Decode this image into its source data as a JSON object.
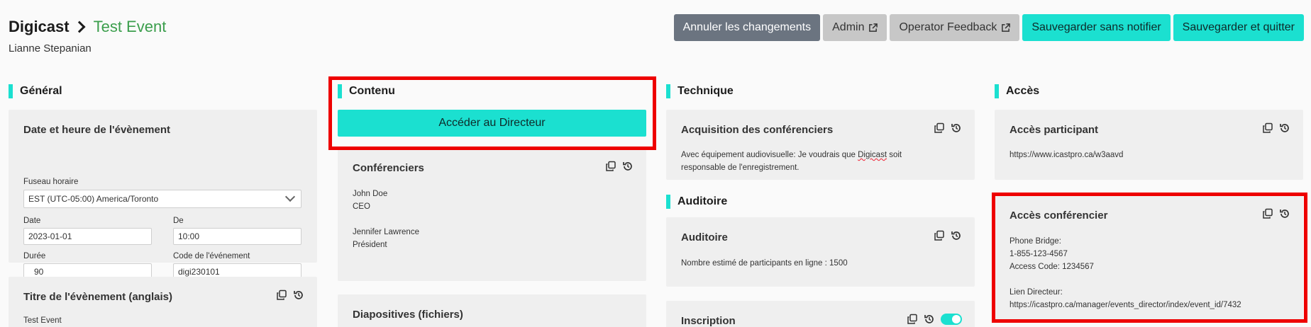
{
  "header": {
    "breadcrumb_root": "Digicast",
    "event_name": "Test Event",
    "user_name": "Lianne Stepanian"
  },
  "toolbar": {
    "cancel_label": "Annuler les changements",
    "admin_label": "Admin",
    "feedback_label": "Operator Feedback",
    "save_no_notify_label": "Sauvegarder sans notifier",
    "save_quit_label": "Sauvegarder et quitter"
  },
  "general": {
    "title": "Général",
    "datetime_card": {
      "title": "Date et heure de l'évènement",
      "timezone_label": "Fuseau horaire",
      "timezone_value": "EST (UTC-05:00) America/Toronto",
      "date_label": "Date",
      "date_value": "2023-01-01",
      "start_label": "De",
      "start_value": "10:00",
      "duration_label": "Durée",
      "duration_value": "90",
      "code_label": "Code de l'événement",
      "code_value": "digi230101"
    },
    "title_card": {
      "title": "Titre de l'évènement (anglais)",
      "value": "Test Event"
    }
  },
  "content": {
    "title": "Contenu",
    "director_button": "Accéder au Directeur",
    "speakers_card": {
      "title": "Conférenciers",
      "speakers": [
        {
          "name": "John Doe",
          "role": "CEO"
        },
        {
          "name": "Jennifer Lawrence",
          "role": "Président"
        }
      ]
    },
    "slides_card": {
      "title": "Diapositives (fichiers)"
    }
  },
  "technical": {
    "title": "Technique",
    "acquisition_card": {
      "title": "Acquisition des conférenciers",
      "text_before": "Avec équipement audiovisuelle: Je voudrais que ",
      "text_flagged": "Digicast",
      "text_after": " soit",
      "text_line2": "responsable de l'enregistrement."
    }
  },
  "audience": {
    "title": "Auditoire",
    "audience_card": {
      "title": "Auditoire",
      "text": "Nombre estimé de participants en ligne : 1500"
    },
    "registration_card": {
      "title": "Inscription"
    }
  },
  "access": {
    "title": "Accès",
    "participant_card": {
      "title": "Accès participant",
      "url": "https://www.icastpro.ca/w3aavd"
    },
    "speaker_card": {
      "title": "Accès conférencier",
      "bridge_label": "Phone Bridge:",
      "bridge_number": "1-855-123-4567",
      "access_code": "Access Code: 1234567",
      "director_label": "Lien Directeur:",
      "director_url": "https://icastpro.ca/manager/events_director/index/event_id/7432"
    }
  },
  "colors": {
    "accent": "#1be0d0",
    "event_green": "#3b9e4c",
    "highlight_red": "#ee0000",
    "dark_button": "#6b7480"
  },
  "icons": {
    "copy": "copy-icon",
    "history": "history-icon",
    "external": "external-link-icon"
  }
}
